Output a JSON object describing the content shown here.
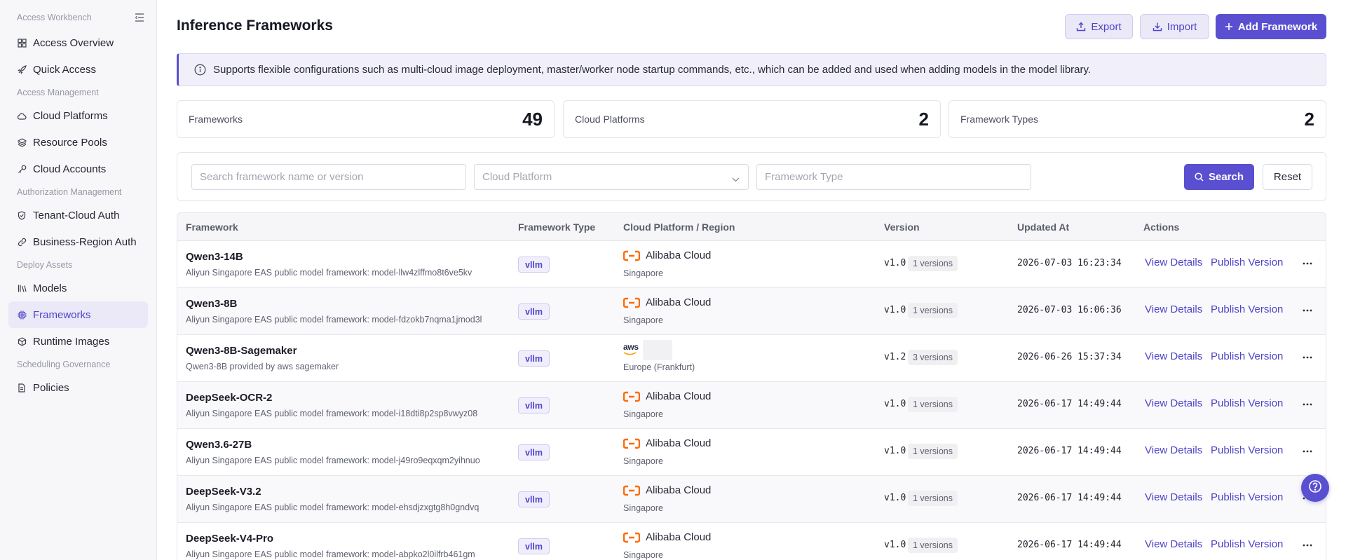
{
  "sidebar": {
    "sections": [
      {
        "title": "Access Workbench",
        "items": [
          {
            "label": "Access Overview",
            "icon": "grid-icon"
          },
          {
            "label": "Quick Access",
            "icon": "rocket-icon"
          }
        ]
      },
      {
        "title": "Access Management",
        "items": [
          {
            "label": "Cloud Platforms",
            "icon": "cloud-icon"
          },
          {
            "label": "Resource Pools",
            "icon": "layers-icon"
          },
          {
            "label": "Cloud Accounts",
            "icon": "key-icon"
          }
        ]
      },
      {
        "title": "Authorization Management",
        "items": [
          {
            "label": "Tenant-Cloud Auth",
            "icon": "shield-icon"
          },
          {
            "label": "Business-Region Auth",
            "icon": "link-icon"
          }
        ]
      },
      {
        "title": "Deploy Assets",
        "items": [
          {
            "label": "Models",
            "icon": "library-icon"
          },
          {
            "label": "Frameworks",
            "icon": "chip-icon",
            "active": true
          },
          {
            "label": "Runtime Images",
            "icon": "package-icon"
          }
        ]
      },
      {
        "title": "Scheduling Governance",
        "items": [
          {
            "label": "Policies",
            "icon": "document-icon"
          }
        ]
      }
    ]
  },
  "header": {
    "title": "Inference Frameworks",
    "export_label": "Export",
    "import_label": "Import",
    "add_label": "Add Framework"
  },
  "notice": "Supports flexible configurations such as multi-cloud image deployment, master/worker node startup commands, etc., which can be added and used when adding models in the model library.",
  "stats": [
    {
      "label": "Frameworks",
      "value": "49"
    },
    {
      "label": "Cloud Platforms",
      "value": "2"
    },
    {
      "label": "Framework Types",
      "value": "2"
    }
  ],
  "filters": {
    "search_placeholder": "Search framework name or version",
    "platform_placeholder": "Cloud Platform",
    "type_placeholder": "Framework Type",
    "search_label": "Search",
    "reset_label": "Reset"
  },
  "table": {
    "columns": [
      "Framework",
      "Framework Type",
      "Cloud Platform / Region",
      "Version",
      "Updated At",
      "Actions"
    ],
    "action_view": "View Details",
    "action_publish": "Publish Version",
    "rows": [
      {
        "name": "Qwen3-14B",
        "desc": "Aliyun Singapore EAS public model framework: model-llw4zlffmo8t6ve5kv",
        "type": "vllm",
        "platform": "Alibaba Cloud",
        "provider": "alibaba",
        "region": "Singapore",
        "version": "v1.0",
        "versions": "1 versions",
        "updated": "2026-07-03 16:23:34"
      },
      {
        "name": "Qwen3-8B",
        "desc": "Aliyun Singapore EAS public model framework: model-fdzokb7nqma1jmod3l",
        "type": "vllm",
        "platform": "Alibaba Cloud",
        "provider": "alibaba",
        "region": "Singapore",
        "version": "v1.0",
        "versions": "1 versions",
        "updated": "2026-07-03 16:06:36"
      },
      {
        "name": "Qwen3-8B-Sagemaker",
        "desc": "Qwen3-8B provided by aws sagemaker",
        "type": "vllm",
        "platform": "",
        "provider": "aws",
        "region": "Europe (Frankfurt)",
        "version": "v1.2",
        "versions": "3 versions",
        "updated": "2026-06-26 15:37:34"
      },
      {
        "name": "DeepSeek-OCR-2",
        "desc": "Aliyun Singapore EAS public model framework: model-i18dti8p2sp8vwyz08",
        "type": "vllm",
        "platform": "Alibaba Cloud",
        "provider": "alibaba",
        "region": "Singapore",
        "version": "v1.0",
        "versions": "1 versions",
        "updated": "2026-06-17 14:49:44"
      },
      {
        "name": "Qwen3.6-27B",
        "desc": "Aliyun Singapore EAS public model framework: model-j49ro9eqxqm2yihnuo",
        "type": "vllm",
        "platform": "Alibaba Cloud",
        "provider": "alibaba",
        "region": "Singapore",
        "version": "v1.0",
        "versions": "1 versions",
        "updated": "2026-06-17 14:49:44"
      },
      {
        "name": "DeepSeek-V3.2",
        "desc": "Aliyun Singapore EAS public model framework: model-ehsdjzxgtg8h0gndvq",
        "type": "vllm",
        "platform": "Alibaba Cloud",
        "provider": "alibaba",
        "region": "Singapore",
        "version": "v1.0",
        "versions": "1 versions",
        "updated": "2026-06-17 14:49:44"
      },
      {
        "name": "DeepSeek-V4-Pro",
        "desc": "Aliyun Singapore EAS public model framework: model-abpko2l0ilfrb461gm",
        "type": "vllm",
        "platform": "Alibaba Cloud",
        "provider": "alibaba",
        "region": "Singapore",
        "version": "v1.0",
        "versions": "1 versions",
        "updated": "2026-06-17 14:49:44"
      }
    ]
  },
  "aws_logo_text": "aws",
  "colors": {
    "accent": "#5a4fd0",
    "alibaba": "#ff6a00"
  }
}
